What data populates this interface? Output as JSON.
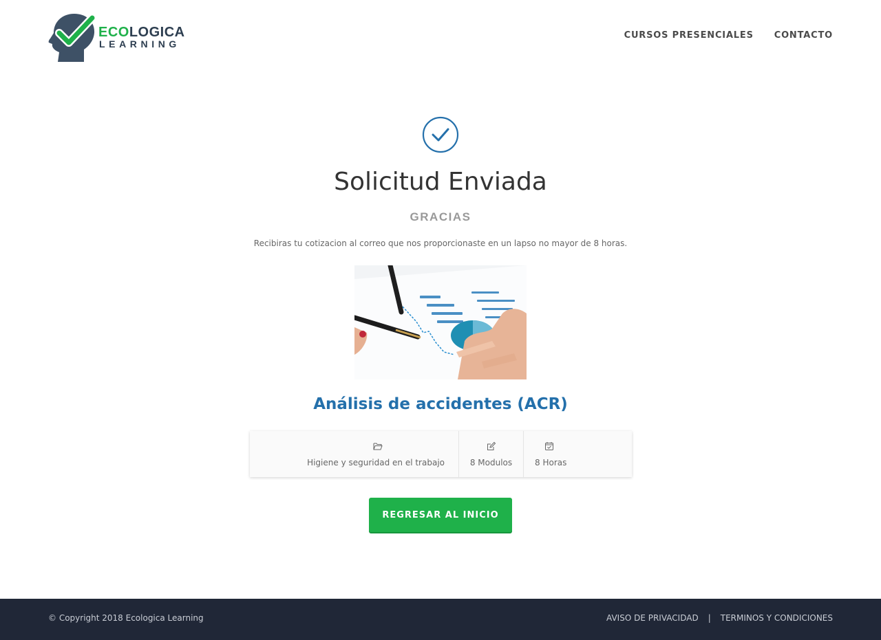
{
  "brand": {
    "name_part1": "ECO",
    "name_part2": "LOGICA",
    "name_line2": "LEARNING",
    "brand_green": "#1fb14a",
    "brand_dark": "#2d3e50"
  },
  "nav": {
    "items": [
      {
        "label": "CURSOS PRESENCIALES"
      },
      {
        "label": "CONTACTO"
      }
    ]
  },
  "main": {
    "icon": "check-circle-icon",
    "title": "Solicitud Enviada",
    "subtitle": "GRACIAS",
    "message": "Recibiras tu cotizacion al correo que nos proporcionaste en un lapso no mayor de 8 horas.",
    "course_title": "Análisis de accidentes (ACR)",
    "course_title_color": "#2470ab",
    "details": [
      {
        "icon": "folder-open-icon",
        "label": "Higiene y seguridad en el trabajo"
      },
      {
        "icon": "edit-icon",
        "label": "8 Modulos"
      },
      {
        "icon": "calendar-check-icon",
        "label": "8 Horas"
      }
    ],
    "button_label": "REGRESAR AL INICIO",
    "button_color": "#1fb14a"
  },
  "footer": {
    "copyright": "© Copyright 2018 Ecologica Learning",
    "links": [
      {
        "label": "AVISO DE PRIVACIDAD"
      },
      {
        "label": "TERMINOS Y CONDICIONES"
      }
    ],
    "separator": "|",
    "background": "#202737"
  }
}
